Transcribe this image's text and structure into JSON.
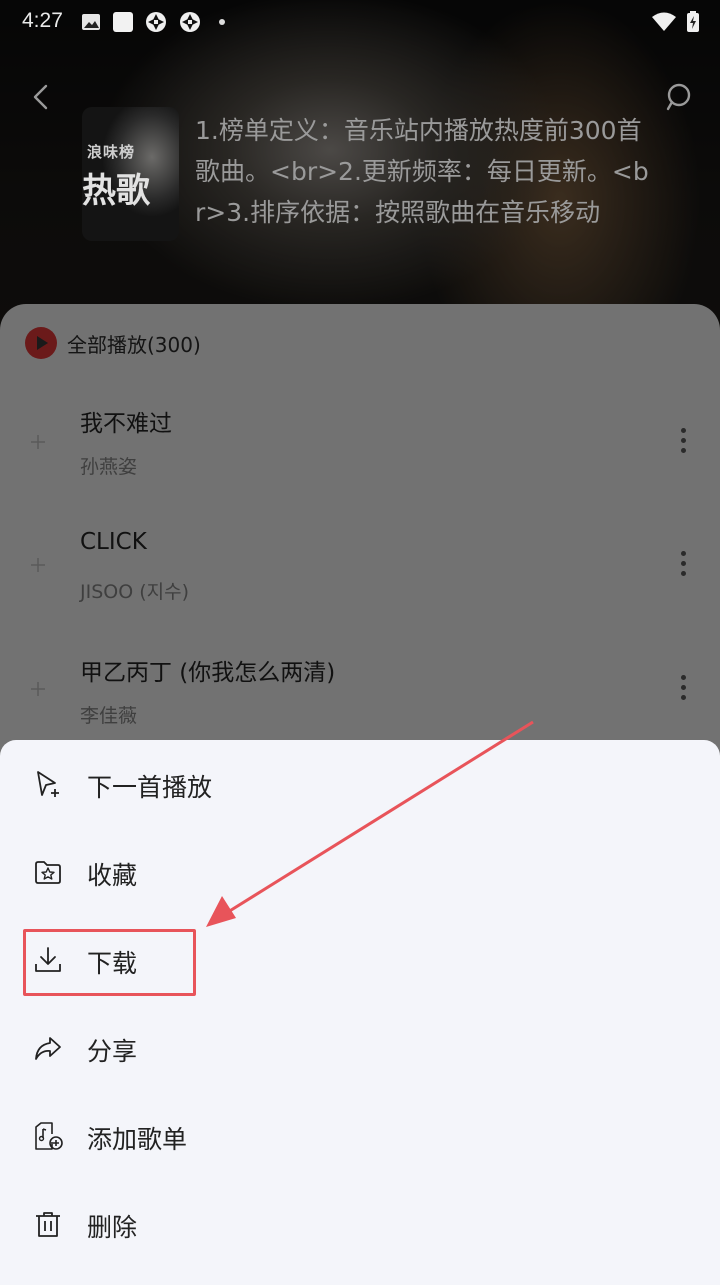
{
  "status_bar": {
    "time": "4:27"
  },
  "header": {
    "cover_small_text": "浪味榜",
    "cover_big_text": "热歌",
    "description": "1.榜单定义：音乐站内播放热度前300首歌曲。<br>2.更新频率：每日更新。<br>3.排序依据：按照歌曲在音乐移动"
  },
  "list": {
    "play_all_label": "全部播放(300)",
    "songs": [
      {
        "title": "我不难过",
        "artist": "孙燕姿"
      },
      {
        "title": "CLICK",
        "artist": "JISOO (지수)"
      },
      {
        "title": "甲乙丙丁 (你我怎么两清)",
        "artist": "李佳薇"
      }
    ]
  },
  "menu": {
    "items": [
      {
        "label": "下一首播放",
        "icon": "play-next-icon"
      },
      {
        "label": "收藏",
        "icon": "favorite-folder-icon"
      },
      {
        "label": "下载",
        "icon": "download-icon"
      },
      {
        "label": "分享",
        "icon": "share-icon"
      },
      {
        "label": "添加歌单",
        "icon": "add-to-playlist-icon"
      },
      {
        "label": "删除",
        "icon": "delete-icon"
      }
    ]
  },
  "colors": {
    "accent_highlight": "#e8545a",
    "play_icon": "#6b1a1a",
    "sheet_bg": "#f4f5fa"
  }
}
